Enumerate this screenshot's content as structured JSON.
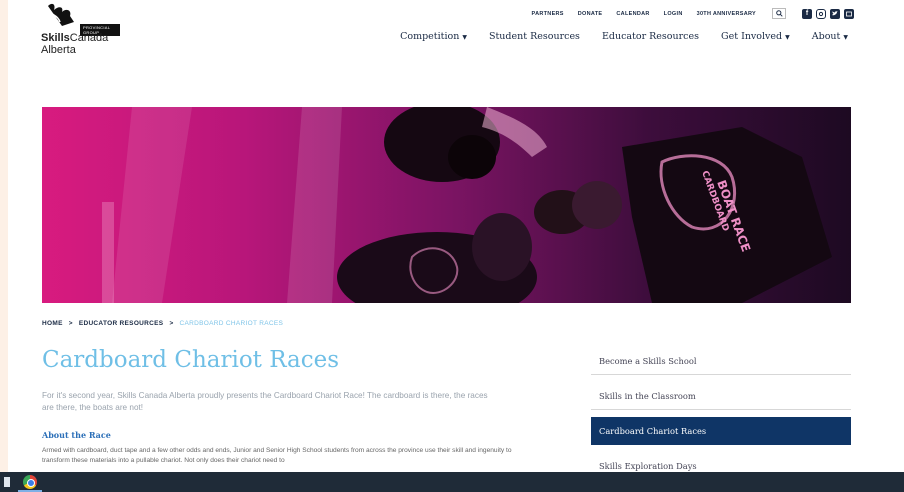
{
  "brand": {
    "tagline": "PROVINCIAL GROUP",
    "name_bold": "Skills",
    "name_rest": "Canada",
    "region": "Alberta"
  },
  "utility_nav": [
    "PARTNERS",
    "DONATE",
    "CALENDAR",
    "LOGIN",
    "30TH ANNIVERSARY"
  ],
  "social_icons": [
    "facebook-icon",
    "instagram-icon",
    "twitter-icon",
    "youtube-icon"
  ],
  "main_nav": [
    {
      "label": "Competition",
      "has_dropdown": true
    },
    {
      "label": "Student Resources",
      "has_dropdown": false
    },
    {
      "label": "Educator Resources",
      "has_dropdown": false
    },
    {
      "label": "Get Involved",
      "has_dropdown": true
    },
    {
      "label": "About",
      "has_dropdown": true
    }
  ],
  "hero": {
    "shirt_text_1": "BOAT RACE",
    "shirt_text_2": "CARDBOARD"
  },
  "breadcrumb": {
    "home": "HOME",
    "sep1": ">",
    "parent": "EDUCATOR RESOURCES",
    "sep2": ">",
    "current": "CARDBOARD CHARIOT RACES"
  },
  "content": {
    "title": "Cardboard Chariot Races",
    "intro": "For it's second year, Skills Canada Alberta proudly presents the Cardboard Chariot Race! The cardboard is there, the races are there, the boats are not!",
    "section_heading": "About the Race",
    "body": "Armed with cardboard, duct tape and a few other odds and ends, Junior and Senior High School students from across the province use their skill and ingenuity to transform these materials into a pullable chariot. Not only does their chariot need to"
  },
  "sidebar": [
    {
      "label": "Become a Skills School",
      "active": false
    },
    {
      "label": "Skills in the Classroom",
      "active": false
    },
    {
      "label": "Cardboard Chariot Races",
      "active": true
    },
    {
      "label": "Skills Exploration Days",
      "active": false
    }
  ],
  "colors": {
    "navy": "#0f3566",
    "title_blue": "#6fbfe6",
    "hero_magenta": "#d81b7f"
  }
}
